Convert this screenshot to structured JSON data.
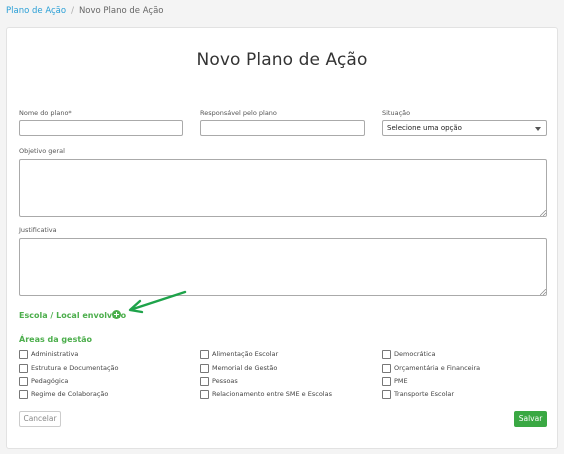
{
  "breadcrumb": {
    "parent": "Plano de Ação",
    "separator": "/",
    "current": "Novo Plano de Ação"
  },
  "page": {
    "title": "Novo Plano de Ação"
  },
  "form": {
    "nome_label": "Nome do plano*",
    "nome_value": "",
    "responsavel_label": "Responsável pelo plano",
    "responsavel_value": "",
    "situacao_label": "Situação",
    "situacao_selected": "Selecione uma opção",
    "objetivo_label": "Objetivo geral",
    "objetivo_value": "",
    "justificativa_label": "Justificativa",
    "justificativa_value": ""
  },
  "escola": {
    "label": "Escola / Local envolvido",
    "add_icon": "plus-circle-icon",
    "arrow_icon": "arrow-pointer-icon"
  },
  "areas": {
    "title": "Áreas da gestão",
    "items": [
      {
        "label": "Administrativa",
        "checked": false
      },
      {
        "label": "Alimentação Escolar",
        "checked": false
      },
      {
        "label": "Democrática",
        "checked": false
      },
      {
        "label": "Estrutura e Documentação",
        "checked": false
      },
      {
        "label": "Memorial de Gestão",
        "checked": false
      },
      {
        "label": "Orçamentária e Financeira",
        "checked": false
      },
      {
        "label": "Pedagógica",
        "checked": false
      },
      {
        "label": "Pessoas",
        "checked": false
      },
      {
        "label": "PME",
        "checked": false
      },
      {
        "label": "Regime de Colaboração",
        "checked": false
      },
      {
        "label": "Relacionamento entre SME e Escolas",
        "checked": false
      },
      {
        "label": "Transporte Escolar",
        "checked": false
      }
    ]
  },
  "actions": {
    "cancel_label": "Cancelar",
    "save_label": "Salvar"
  },
  "colors": {
    "accent_green": "#3aa843",
    "link_blue": "#2a9fd6",
    "arrow_green": "#1ea34a"
  }
}
